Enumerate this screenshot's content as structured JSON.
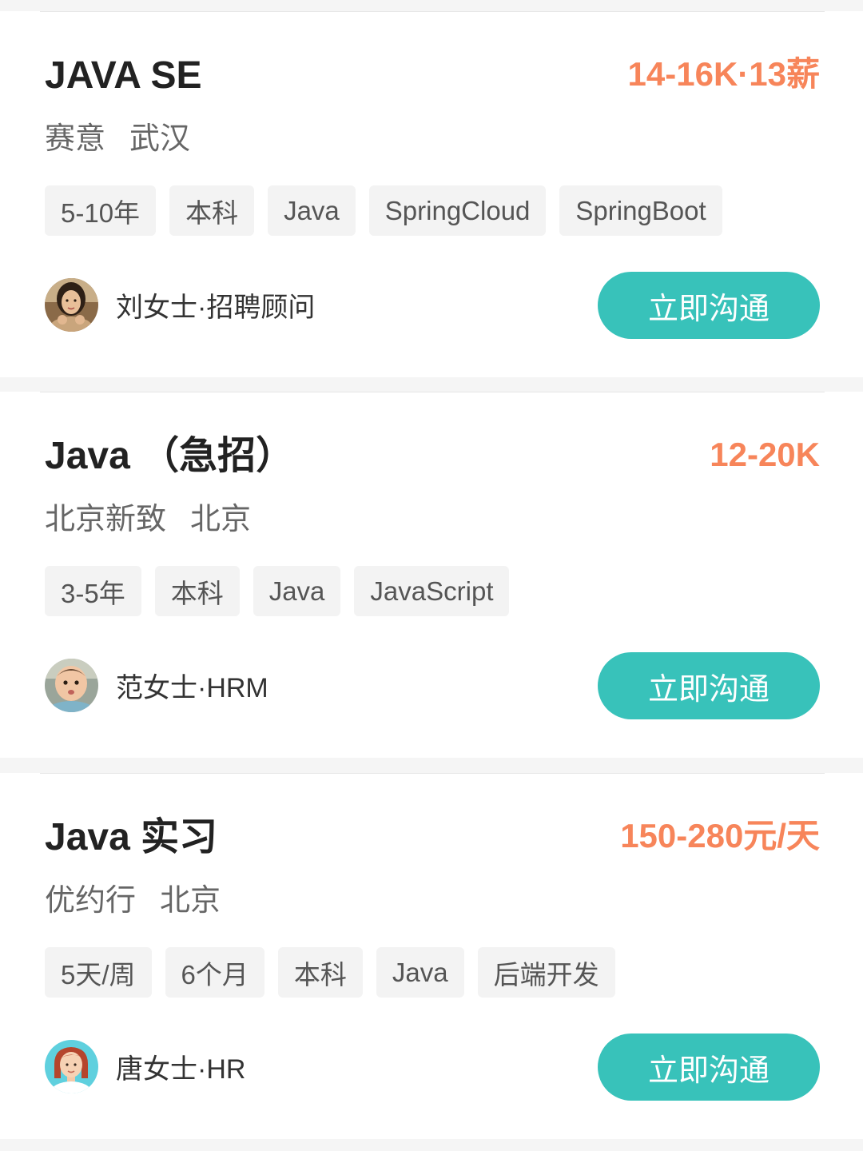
{
  "jobs": [
    {
      "title": "JAVA SE",
      "salary": "14-16K·13薪",
      "company": "赛意",
      "city": "武汉",
      "tags": [
        "5-10年",
        "本科",
        "Java",
        "SpringCloud",
        "SpringBoot"
      ],
      "recruiter": "刘女士·招聘顾问",
      "avatar": "recruiter-photo-woman",
      "button_label": "立即沟通"
    },
    {
      "title": "Java （急招）",
      "salary": "12-20K",
      "company": "北京新致",
      "city": "北京",
      "tags": [
        "3-5年",
        "本科",
        "Java",
        "JavaScript"
      ],
      "recruiter": "范女士·HRM",
      "avatar": "recruiter-photo-baby",
      "button_label": "立即沟通"
    },
    {
      "title": "Java 实习",
      "salary": "150-280元/天",
      "company": "优约行",
      "city": "北京",
      "tags": [
        "5天/周",
        "6个月",
        "本科",
        "Java",
        "后端开发"
      ],
      "recruiter": "唐女士·HR",
      "avatar": "recruiter-cartoon-avatar",
      "button_label": "立即沟通"
    }
  ],
  "colors": {
    "salary": "#f7855a",
    "button": "#38c2ba",
    "tag_background": "#f3f3f3",
    "page_background": "#f5f5f5"
  }
}
